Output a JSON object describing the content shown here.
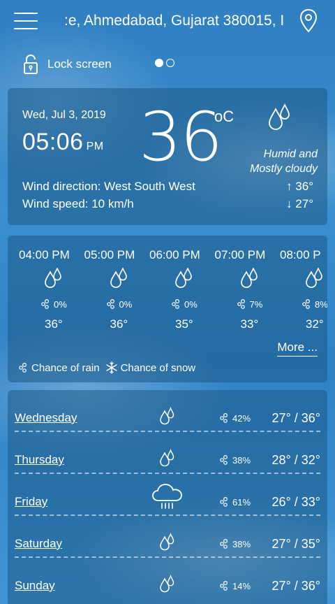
{
  "header": {
    "location": ":e, Ahmedabad, Gujarat 380015, I"
  },
  "lock": {
    "label": "Lock screen"
  },
  "current": {
    "date": "Wed, Jul 3, 2019",
    "time": "05:06",
    "ampm": "PM",
    "temperature": "36",
    "unit": "oC",
    "condition_line1": "Humid and",
    "condition_line2": "Mostly cloudy",
    "wind_direction": "Wind direction: West South West",
    "wind_speed": "Wind speed: 10 km/h",
    "high": "↑ 36°",
    "low": "↓ 27°"
  },
  "hourly": [
    {
      "time": "04:00 PM",
      "rain": "0%",
      "temp": "36°"
    },
    {
      "time": "05:00 PM",
      "rain": "0%",
      "temp": "36°"
    },
    {
      "time": "06:00 PM",
      "rain": "0%",
      "temp": "35°"
    },
    {
      "time": "07:00 PM",
      "rain": "7%",
      "temp": "33°"
    },
    {
      "time": "08:00 P",
      "rain": "8%",
      "temp": "32°"
    }
  ],
  "more_label": "More ...",
  "legend": {
    "rain": "Chance of rain",
    "snow": "Chance of snow"
  },
  "daily": [
    {
      "day": "Wednesday",
      "icon": "drops-icon",
      "rain": "42%",
      "temps": "27° / 36°"
    },
    {
      "day": "Thursday",
      "icon": "drops-icon",
      "rain": "38%",
      "temps": "28° / 32°"
    },
    {
      "day": "Friday",
      "icon": "rain-cloud-icon",
      "rain": "61%",
      "temps": "26° / 33°"
    },
    {
      "day": "Saturday",
      "icon": "drops-icon",
      "rain": "38%",
      "temps": "27° / 35°"
    },
    {
      "day": "Sunday",
      "icon": "drops-icon",
      "rain": "14%",
      "temps": "27° / 36°"
    }
  ]
}
